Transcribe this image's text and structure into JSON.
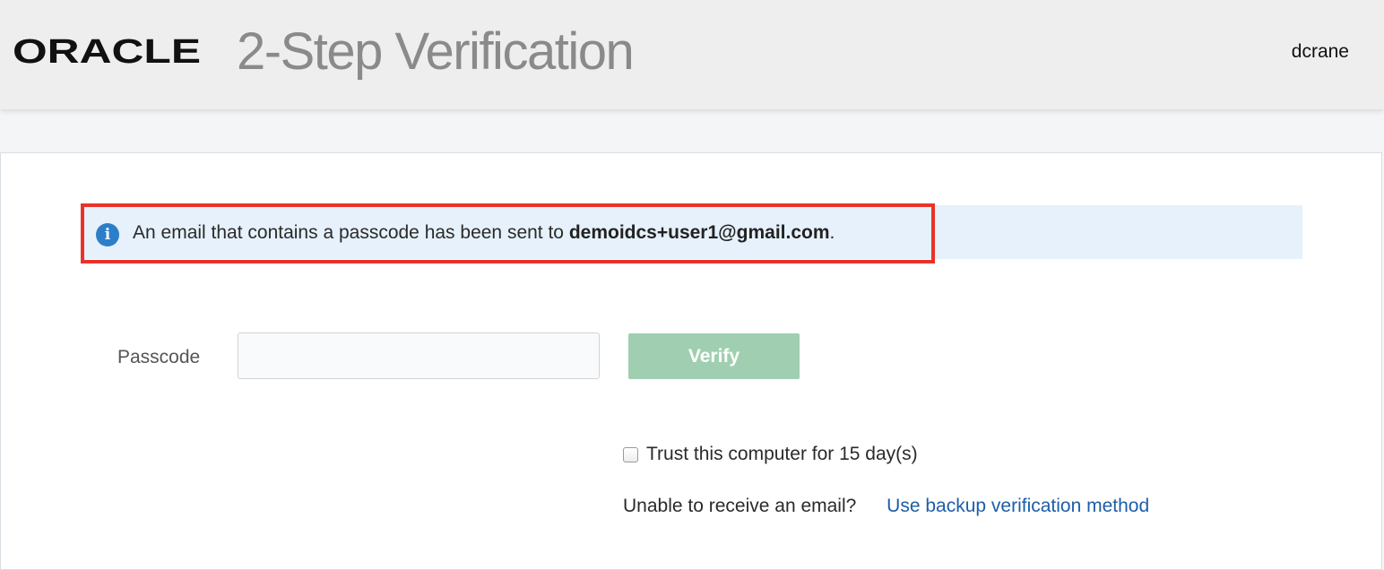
{
  "header": {
    "logo_text": "ORACLE",
    "title": "2-Step Verification",
    "username": "dcrane"
  },
  "info": {
    "message_prefix": "An email that contains a passcode has been sent to ",
    "email": "demoidcs+user1@gmail.com",
    "message_suffix": ".",
    "icon": "info-icon"
  },
  "form": {
    "passcode_label": "Passcode",
    "passcode_value": "",
    "passcode_placeholder": "",
    "verify_label": "Verify",
    "trust_label": "Trust this computer for 15 day(s)",
    "trust_checked": false,
    "backup_question": "Unable to receive an email?",
    "backup_link": "Use backup verification method"
  },
  "colors": {
    "header_bg": "#eeeeee",
    "title_gray": "#8a8a8a",
    "info_bg": "#e6f1fb",
    "highlight_red": "#e8332a",
    "info_icon_blue": "#2d7ec8",
    "verify_green_disabled": "#9fcfb0",
    "link_blue": "#1c5ea8"
  }
}
